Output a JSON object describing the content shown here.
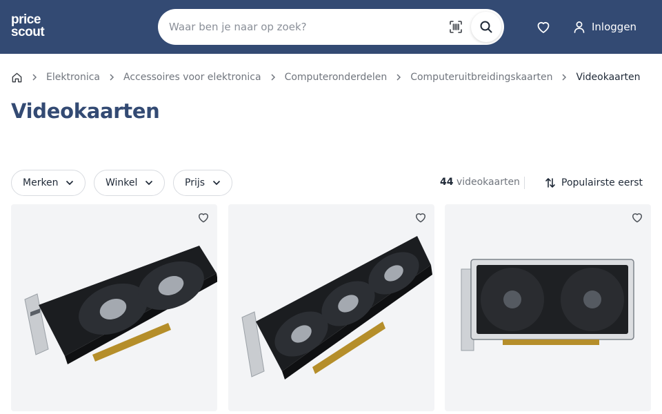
{
  "header": {
    "logo_line1": "price",
    "logo_line2": "scout",
    "search_placeholder": "Waar ben je naar op zoek?",
    "login_label": "Inloggen"
  },
  "breadcrumb": {
    "items": [
      "Elektronica",
      "Accessoires voor elektronica",
      "Computeronderdelen",
      "Computeruitbreidingskaarten"
    ],
    "current": "Videokaarten"
  },
  "page": {
    "title": "Videokaarten"
  },
  "filters": {
    "brands": "Merken",
    "shop": "Winkel",
    "price": "Prijs"
  },
  "results": {
    "count": "44",
    "unit": "videokaarten",
    "sort_label": "Populairste eerst"
  },
  "colors": {
    "header_bg": "#334a73",
    "title": "#334a73",
    "card_bg": "#f3f4f6"
  }
}
